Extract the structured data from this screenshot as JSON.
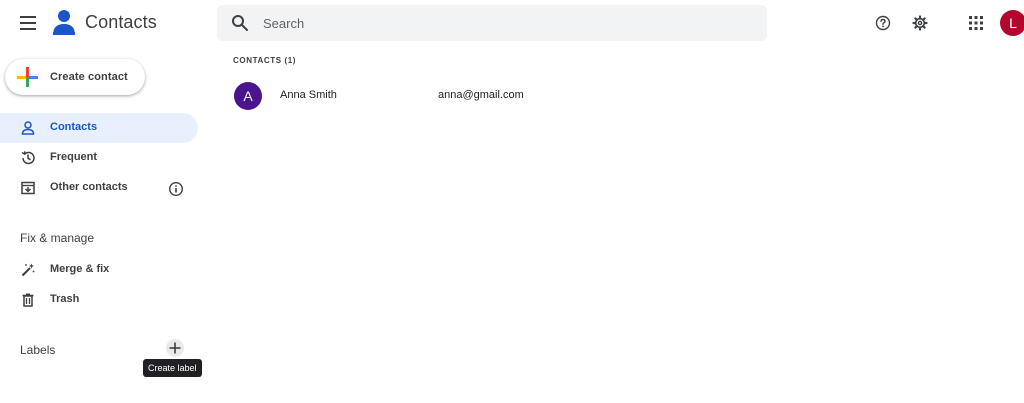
{
  "app": {
    "title": "Contacts"
  },
  "header": {
    "search_placeholder": "Search",
    "user_initial": "L",
    "icons": {
      "menu": "hamburger-menu-icon",
      "help": "help-circle-icon",
      "settings": "gear-icon",
      "apps": "apps-grid-icon",
      "search": "search-icon"
    }
  },
  "sidebar": {
    "create_contact_label": "Create contact",
    "items": [
      {
        "label": "Contacts",
        "icon": "person-icon",
        "active": true
      },
      {
        "label": "Frequent",
        "icon": "history-icon",
        "active": false
      },
      {
        "label": "Other contacts",
        "icon": "archive-icon",
        "active": false
      }
    ],
    "fix_manage_title": "Fix & manage",
    "fix_items": [
      {
        "label": "Merge & fix",
        "icon": "magic-wand-icon"
      },
      {
        "label": "Trash",
        "icon": "trash-icon"
      }
    ],
    "labels_title": "Labels",
    "create_label_tooltip": "Create label"
  },
  "main": {
    "heading": "CONTACTS (1)",
    "contacts": [
      {
        "initial": "A",
        "name": "Anna Smith",
        "email": "anna@gmail.com"
      }
    ]
  },
  "colors": {
    "accent": "#1a56c8",
    "active_bg": "#e8f0fe",
    "avatar_user": "#b3062c",
    "avatar_contact": "#4a148c",
    "search_bg": "#f1f3f4"
  }
}
